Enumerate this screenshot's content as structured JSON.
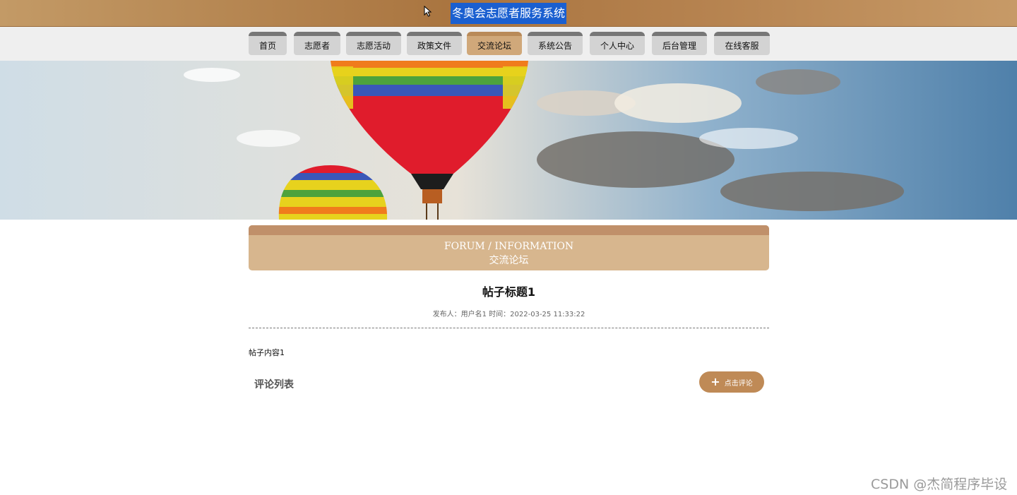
{
  "header": {
    "site_title": "冬奥会志愿者服务系统"
  },
  "nav": {
    "items": [
      {
        "label": "首页"
      },
      {
        "label": "志愿者"
      },
      {
        "label": "志愿活动"
      },
      {
        "label": "政策文件"
      },
      {
        "label": "交流论坛",
        "active": true
      },
      {
        "label": "系统公告"
      },
      {
        "label": "个人中心"
      },
      {
        "label": "后台管理"
      },
      {
        "label": "在线客服"
      }
    ]
  },
  "section": {
    "title_en": "FORUM / INFORMATION",
    "title_cn": "交流论坛"
  },
  "post": {
    "title": "帖子标题1",
    "meta": "发布人：用户名1 时间：2022-03-25 11:33:22",
    "content": "帖子内容1"
  },
  "comments": {
    "label": "评论列表",
    "button_label": "点击评论",
    "button_icon": "plus-icon"
  },
  "watermark": "CSDN @杰简程序毕设",
  "colors": {
    "topbar": "#a9743f",
    "title_highlight": "#1a5fd0",
    "nav_active": "#d0a87a",
    "section_header": "#d7b68e",
    "comment_button": "#bf8a56"
  }
}
